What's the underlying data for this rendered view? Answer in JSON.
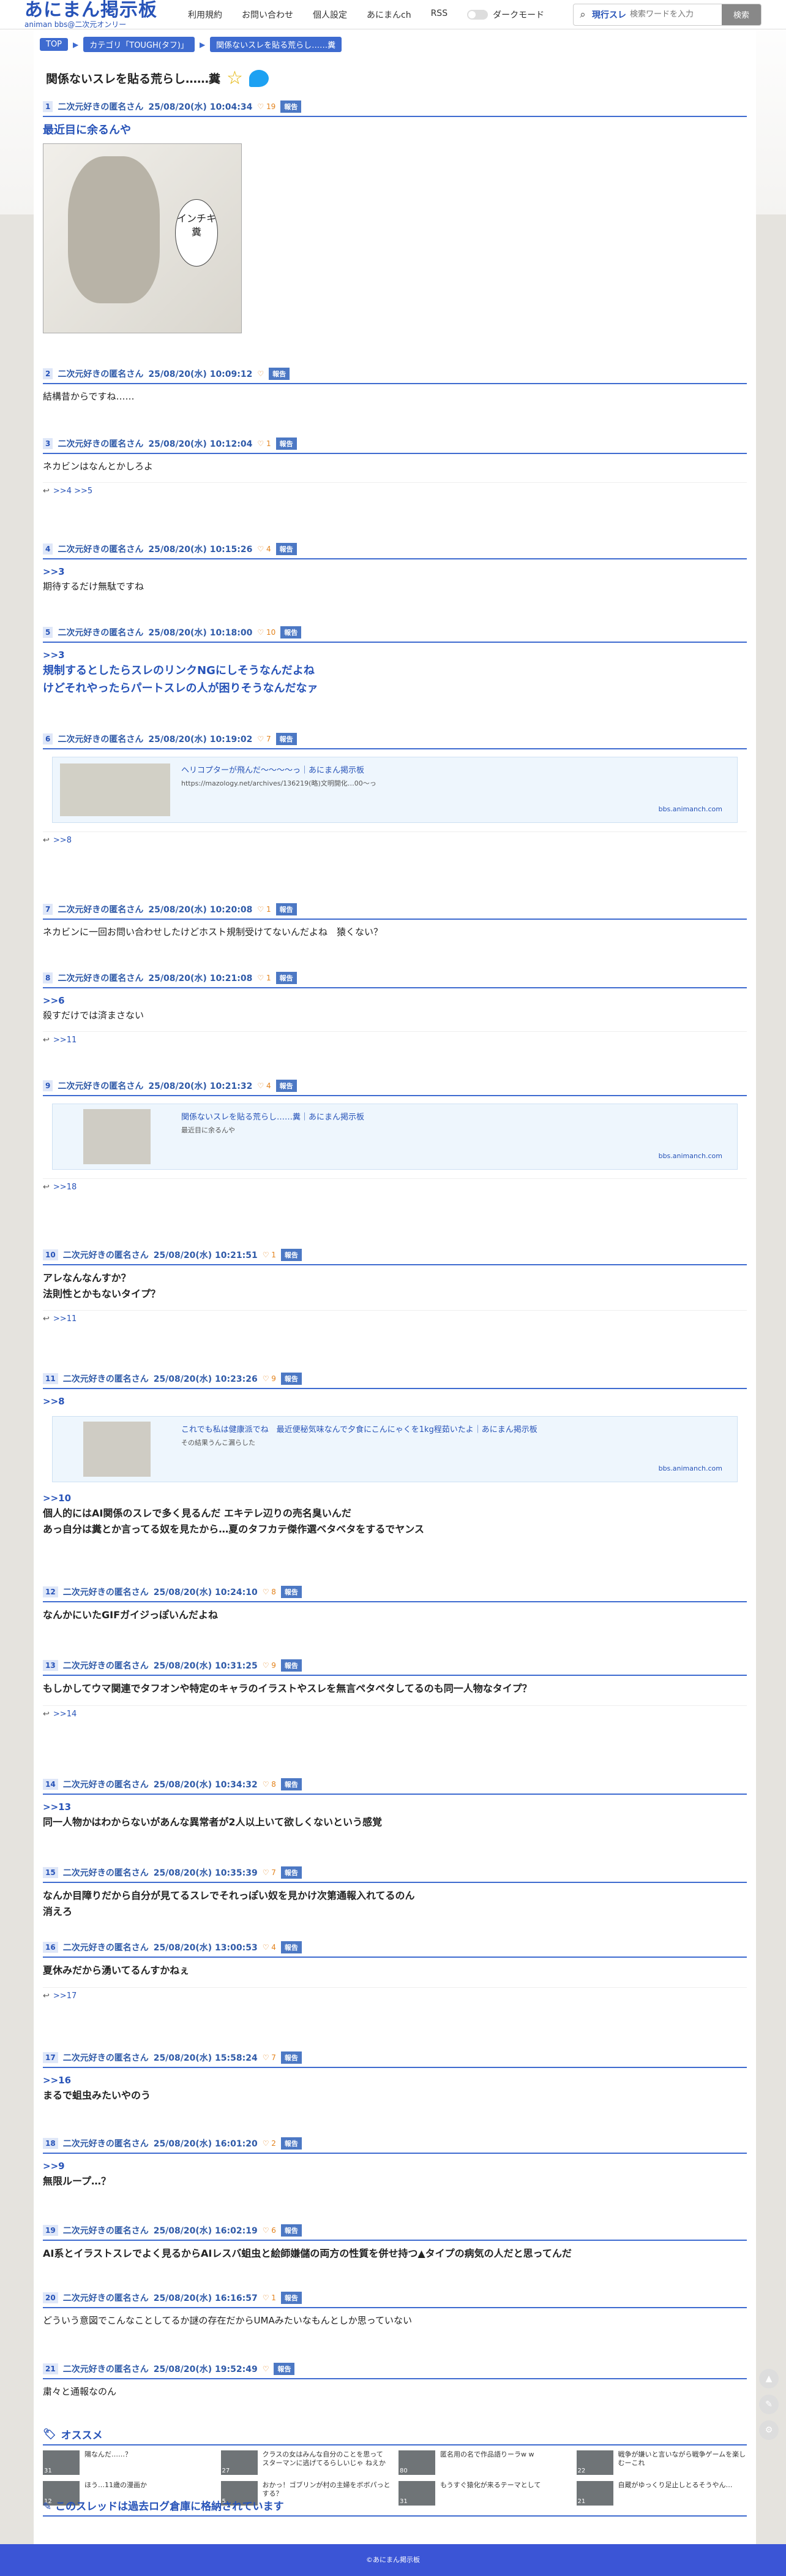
{
  "site": {
    "title": "あにまん掲示板",
    "subtitle": "animan bbs@二次元オンリー"
  },
  "nav": [
    "利用規約",
    "お問い合わせ",
    "個人設定",
    "あにまんch",
    "RSS"
  ],
  "dark_label": "ダークモード",
  "search": {
    "label": "現行スレ",
    "placeholder": "検索ワードを入力",
    "button": "検索"
  },
  "crumbs": [
    "TOP",
    "カテゴリ「TOUGH(タフ)」",
    "関係ないスレを貼る荒らし……糞"
  ],
  "thread_title": "関係ないスレを貼る荒らし……糞",
  "posts": [
    {
      "n": "1",
      "name": "二次元好きの匿名さん",
      "date": "25/08/20(水) 10:04:34",
      "likes": "19",
      "report": "報告",
      "lines": [
        "最近目に余るんや"
      ],
      "style": "blue",
      "image": {
        "caption": "インチキ 糞"
      }
    },
    {
      "n": "2",
      "name": "二次元好きの匿名さん",
      "date": "25/08/20(水) 10:09:12",
      "likes": "",
      "report": "報告",
      "lines": [
        "結構昔からですね……"
      ]
    },
    {
      "n": "3",
      "name": "二次元好きの匿名さん",
      "date": "25/08/20(水) 10:12:04",
      "likes": "1",
      "report": "報告",
      "lines": [
        "ネカビンはなんとかしろよ"
      ],
      "refs": ">>4  >>5"
    },
    {
      "n": "4",
      "name": "二次元好きの匿名さん",
      "date": "25/08/20(水) 10:15:26",
      "likes": "4",
      "report": "報告",
      "quote": ">>3",
      "lines": [
        "期待するだけ無駄ですね"
      ]
    },
    {
      "n": "5",
      "name": "二次元好きの匿名さん",
      "date": "25/08/20(水) 10:18:00",
      "likes": "10",
      "report": "報告",
      "quote": ">>3",
      "lines": [
        "規制するとしたらスレのリンクNGにしそうなんだよね",
        "けどそれやったらパートスレの人が困りそうなんだなァ"
      ],
      "style": "blue"
    },
    {
      "n": "6",
      "name": "二次元好きの匿名さん",
      "date": "25/08/20(水) 10:19:02",
      "likes": "7",
      "report": "報告",
      "card": {
        "title": "ヘリコプターが飛んだ〜〜〜〜っ｜あにまん掲示板",
        "url": "https://mazology.net/archives/136219(略)文明開化…00〜っ",
        "domain": "bbs.animanch.com"
      },
      "refs": ">>8"
    },
    {
      "n": "7",
      "name": "二次元好きの匿名さん",
      "date": "25/08/20(水) 10:20:08",
      "likes": "1",
      "report": "報告",
      "lines": [
        "ネカビンに一回お問い合わせしたけどホスト規制受けてないんだよね　猿くない？"
      ]
    },
    {
      "n": "8",
      "name": "二次元好きの匿名さん",
      "date": "25/08/20(水) 10:21:08",
      "likes": "1",
      "report": "報告",
      "quote": ">>6",
      "lines": [
        "殺すだけでは済まさない"
      ],
      "refs": ">>11"
    },
    {
      "n": "9",
      "name": "二次元好きの匿名さん",
      "date": "25/08/20(水) 10:21:32",
      "likes": "4",
      "report": "報告",
      "card": {
        "title": "関係ないスレを貼る荒らし……糞｜あにまん掲示板",
        "url": "最近目に余るんや",
        "domain": "bbs.animanch.com"
      },
      "refs": ">>18"
    },
    {
      "n": "10",
      "name": "二次元好きの匿名さん",
      "date": "25/08/20(水) 10:21:51",
      "likes": "1",
      "report": "報告",
      "lines": [
        "アレなんなんすか？",
        "法則性とかもないタイプ？"
      ],
      "refs": ">>11",
      "style": "bold"
    },
    {
      "n": "11",
      "name": "二次元好きの匿名さん",
      "date": "25/08/20(水) 10:23:26",
      "likes": "9",
      "report": "報告",
      "quote": ">>8",
      "card": {
        "title": "これでも私は健康派でね　最近便秘気味なんで夕食にこんにゃくを1kg程茹いたよ｜あにまん掲示板",
        "url": "その結果うんこ漏らした",
        "domain": "bbs.animanch.com"
      },
      "quote2": ">>10",
      "lines": [
        "個人的にはAI関係のスレで多く見るんだ エキテレ辺りの売名臭いんだ",
        "あっ自分は糞とか言ってる奴を見たから…夏のタフカテ傑作選ベタベタをするでヤンス"
      ],
      "style": "bold"
    },
    {
      "n": "12",
      "name": "二次元好きの匿名さん",
      "date": "25/08/20(水) 10:24:10",
      "likes": "8",
      "report": "報告",
      "lines": [
        "なんかにいたGIFガイジっぽいんだよね"
      ],
      "style": "bold"
    },
    {
      "n": "13",
      "name": "二次元好きの匿名さん",
      "date": "25/08/20(水) 10:31:25",
      "likes": "9",
      "report": "報告",
      "lines": [
        "もしかしてウマ関連でタフオンや特定のキャラのイラストやスレを無言ペタペタしてるのも同一人物なタイプ？"
      ],
      "refs": ">>14",
      "style": "bold"
    },
    {
      "n": "14",
      "name": "二次元好きの匿名さん",
      "date": "25/08/20(水) 10:34:32",
      "likes": "8",
      "report": "報告",
      "quote": ">>13",
      "lines": [
        "同一人物かはわからないがあんな異常者が2人以上いて欲しくないという感覚"
      ],
      "style": "bold"
    },
    {
      "n": "15",
      "name": "二次元好きの匿名さん",
      "date": "25/08/20(水) 10:35:39",
      "likes": "7",
      "report": "報告",
      "lines": [
        "なんか目障りだから自分が見てるスレでそれっぽい奴を見かけ次第通報入れてるのん",
        "消えろ"
      ],
      "style": "bold"
    },
    {
      "n": "16",
      "name": "二次元好きの匿名さん",
      "date": "25/08/20(水) 13:00:53",
      "likes": "4",
      "report": "報告",
      "lines": [
        "夏休みだから湧いてるんすかねぇ"
      ],
      "refs": ">>17",
      "style": "bold"
    },
    {
      "n": "17",
      "name": "二次元好きの匿名さん",
      "date": "25/08/20(水) 15:58:24",
      "likes": "7",
      "report": "報告",
      "quote": ">>16",
      "lines": [
        "まるで蛆虫みたいやのう"
      ],
      "style": "bold"
    },
    {
      "n": "18",
      "name": "二次元好きの匿名さん",
      "date": "25/08/20(水) 16:01:20",
      "likes": "2",
      "report": "報告",
      "quote": ">>9",
      "lines": [
        "無限ループ…？"
      ],
      "style": "bold"
    },
    {
      "n": "19",
      "name": "二次元好きの匿名さん",
      "date": "25/08/20(水) 16:02:19",
      "likes": "6",
      "report": "報告",
      "lines": [
        "AI系とイラストスレでよく見るからAIレスバ蛆虫と絵師嫌儲の両方の性質を併せ持つ▲タイプの病気の人だと思ってんだ"
      ],
      "style": "bold"
    },
    {
      "n": "20",
      "name": "二次元好きの匿名さん",
      "date": "25/08/20(水) 16:16:57",
      "likes": "1",
      "report": "報告",
      "lines": [
        "どういう意図でこんなことしてるか謎の存在だからUMAみたいなもんとしか思っていない"
      ]
    },
    {
      "n": "21",
      "name": "二次元好きの匿名さん",
      "date": "25/08/20(水) 19:52:49",
      "likes": "",
      "report": "報告",
      "lines": [
        "粛々と通報なのん"
      ]
    }
  ],
  "recs": {
    "heading": "オススメ",
    "items": [
      {
        "text": "陽なんだ……？",
        "count": "31"
      },
      {
        "text": "クラスの女はみんな自分のことを思って スターマンに逃げてるらしいじゃ ねえか",
        "count": "27"
      },
      {
        "text": "匿名用の名で作品語りーラw w",
        "count": "80"
      },
      {
        "text": "戦争が嫌いと言いながら戦争ゲームを楽しむーこれ",
        "count": "22"
      },
      {
        "text": "ほう…11歳の漫画か",
        "count": "12"
      },
      {
        "text": "おかっ！ゴブリンが村の主婦をボボパっとする？",
        "count": "5"
      },
      {
        "text": "もうすぐ猿化が来るテーマとして",
        "count": "31"
      },
      {
        "text": "自蔵がゆっくり足止しとるそうやん…",
        "count": "21"
      }
    ]
  },
  "archive_text": "このスレッドは過去ログ倉庫に格納されています",
  "footer": "©あにまん掲示板"
}
